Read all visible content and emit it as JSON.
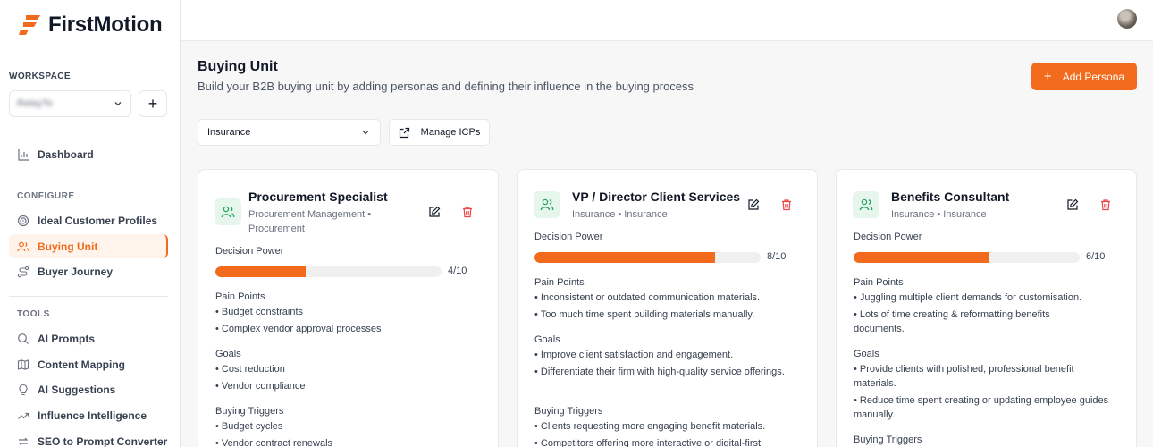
{
  "brand": {
    "name": "FirstMotion",
    "accent": "#f26b1d"
  },
  "sidebar": {
    "workspace_label": "WORKSPACE",
    "workspace_value": "RelayTo",
    "add_label": "+",
    "dashboard": "Dashboard",
    "configure_label": "CONFIGURE",
    "configure_items": [
      {
        "label": "Ideal Customer Profiles",
        "icon": "target-icon"
      },
      {
        "label": "Buying Unit",
        "icon": "users-icon",
        "active": true
      },
      {
        "label": "Buyer Journey",
        "icon": "route-icon"
      }
    ],
    "tools_label": "TOOLS",
    "tools_items": [
      {
        "label": "AI Prompts",
        "icon": "search-icon"
      },
      {
        "label": "Content Mapping",
        "icon": "map-icon"
      },
      {
        "label": "AI Suggestions",
        "icon": "lightbulb-icon"
      },
      {
        "label": "Influence Intelligence",
        "icon": "trending-icon"
      },
      {
        "label": "SEO to Prompt Converter",
        "icon": "arrows-icon"
      }
    ]
  },
  "header": {
    "title": "Buying Unit",
    "subtitle": "Build your B2B buying unit by adding personas and defining their influence in the buying process",
    "add_button": "Add Persona",
    "filter_value": "Insurance",
    "manage_button": "Manage ICPs"
  },
  "labels": {
    "decision_power": "Decision Power",
    "pain_points": "Pain Points",
    "goals": "Goals",
    "buying_triggers": "Buying Triggers"
  },
  "cards": [
    {
      "title": "Procurement Specialist",
      "meta_line1": "Procurement Management •",
      "meta_line2": "Procurement",
      "power": 4,
      "power_text": "4/10",
      "pain_points": [
        "• Budget constraints",
        "• Complex vendor approval processes"
      ],
      "goals": [
        "• Cost reduction",
        "• Vendor compliance"
      ],
      "triggers": [
        "• Budget cycles",
        "• Vendor contract renewals"
      ]
    },
    {
      "title": "VP / Director Client Services",
      "meta_line1": "Insurance • Insurance",
      "power": 8,
      "power_text": "8/10",
      "pain_points": [
        "• Inconsistent or outdated communication materials.",
        "• Too much time spent building materials manually."
      ],
      "goals": [
        "• Improve client satisfaction and engagement.",
        "• Differentiate their firm with high-quality service offerings."
      ],
      "triggers": [
        "• Clients requesting more engaging benefit materials.",
        "• Competitors offering more interactive or digital-first"
      ]
    },
    {
      "title": "Benefits Consultant",
      "meta_line1": "Insurance • Insurance",
      "power": 6,
      "power_text": "6/10",
      "pain_points": [
        "• Juggling multiple client demands for customisation.",
        "• Lots of time creating & reformatting benefits documents."
      ],
      "goals": [
        "• Provide clients with polished, professional benefit materials.",
        "• Reduce time spent creating or updating employee guides manually."
      ],
      "triggers": []
    }
  ]
}
